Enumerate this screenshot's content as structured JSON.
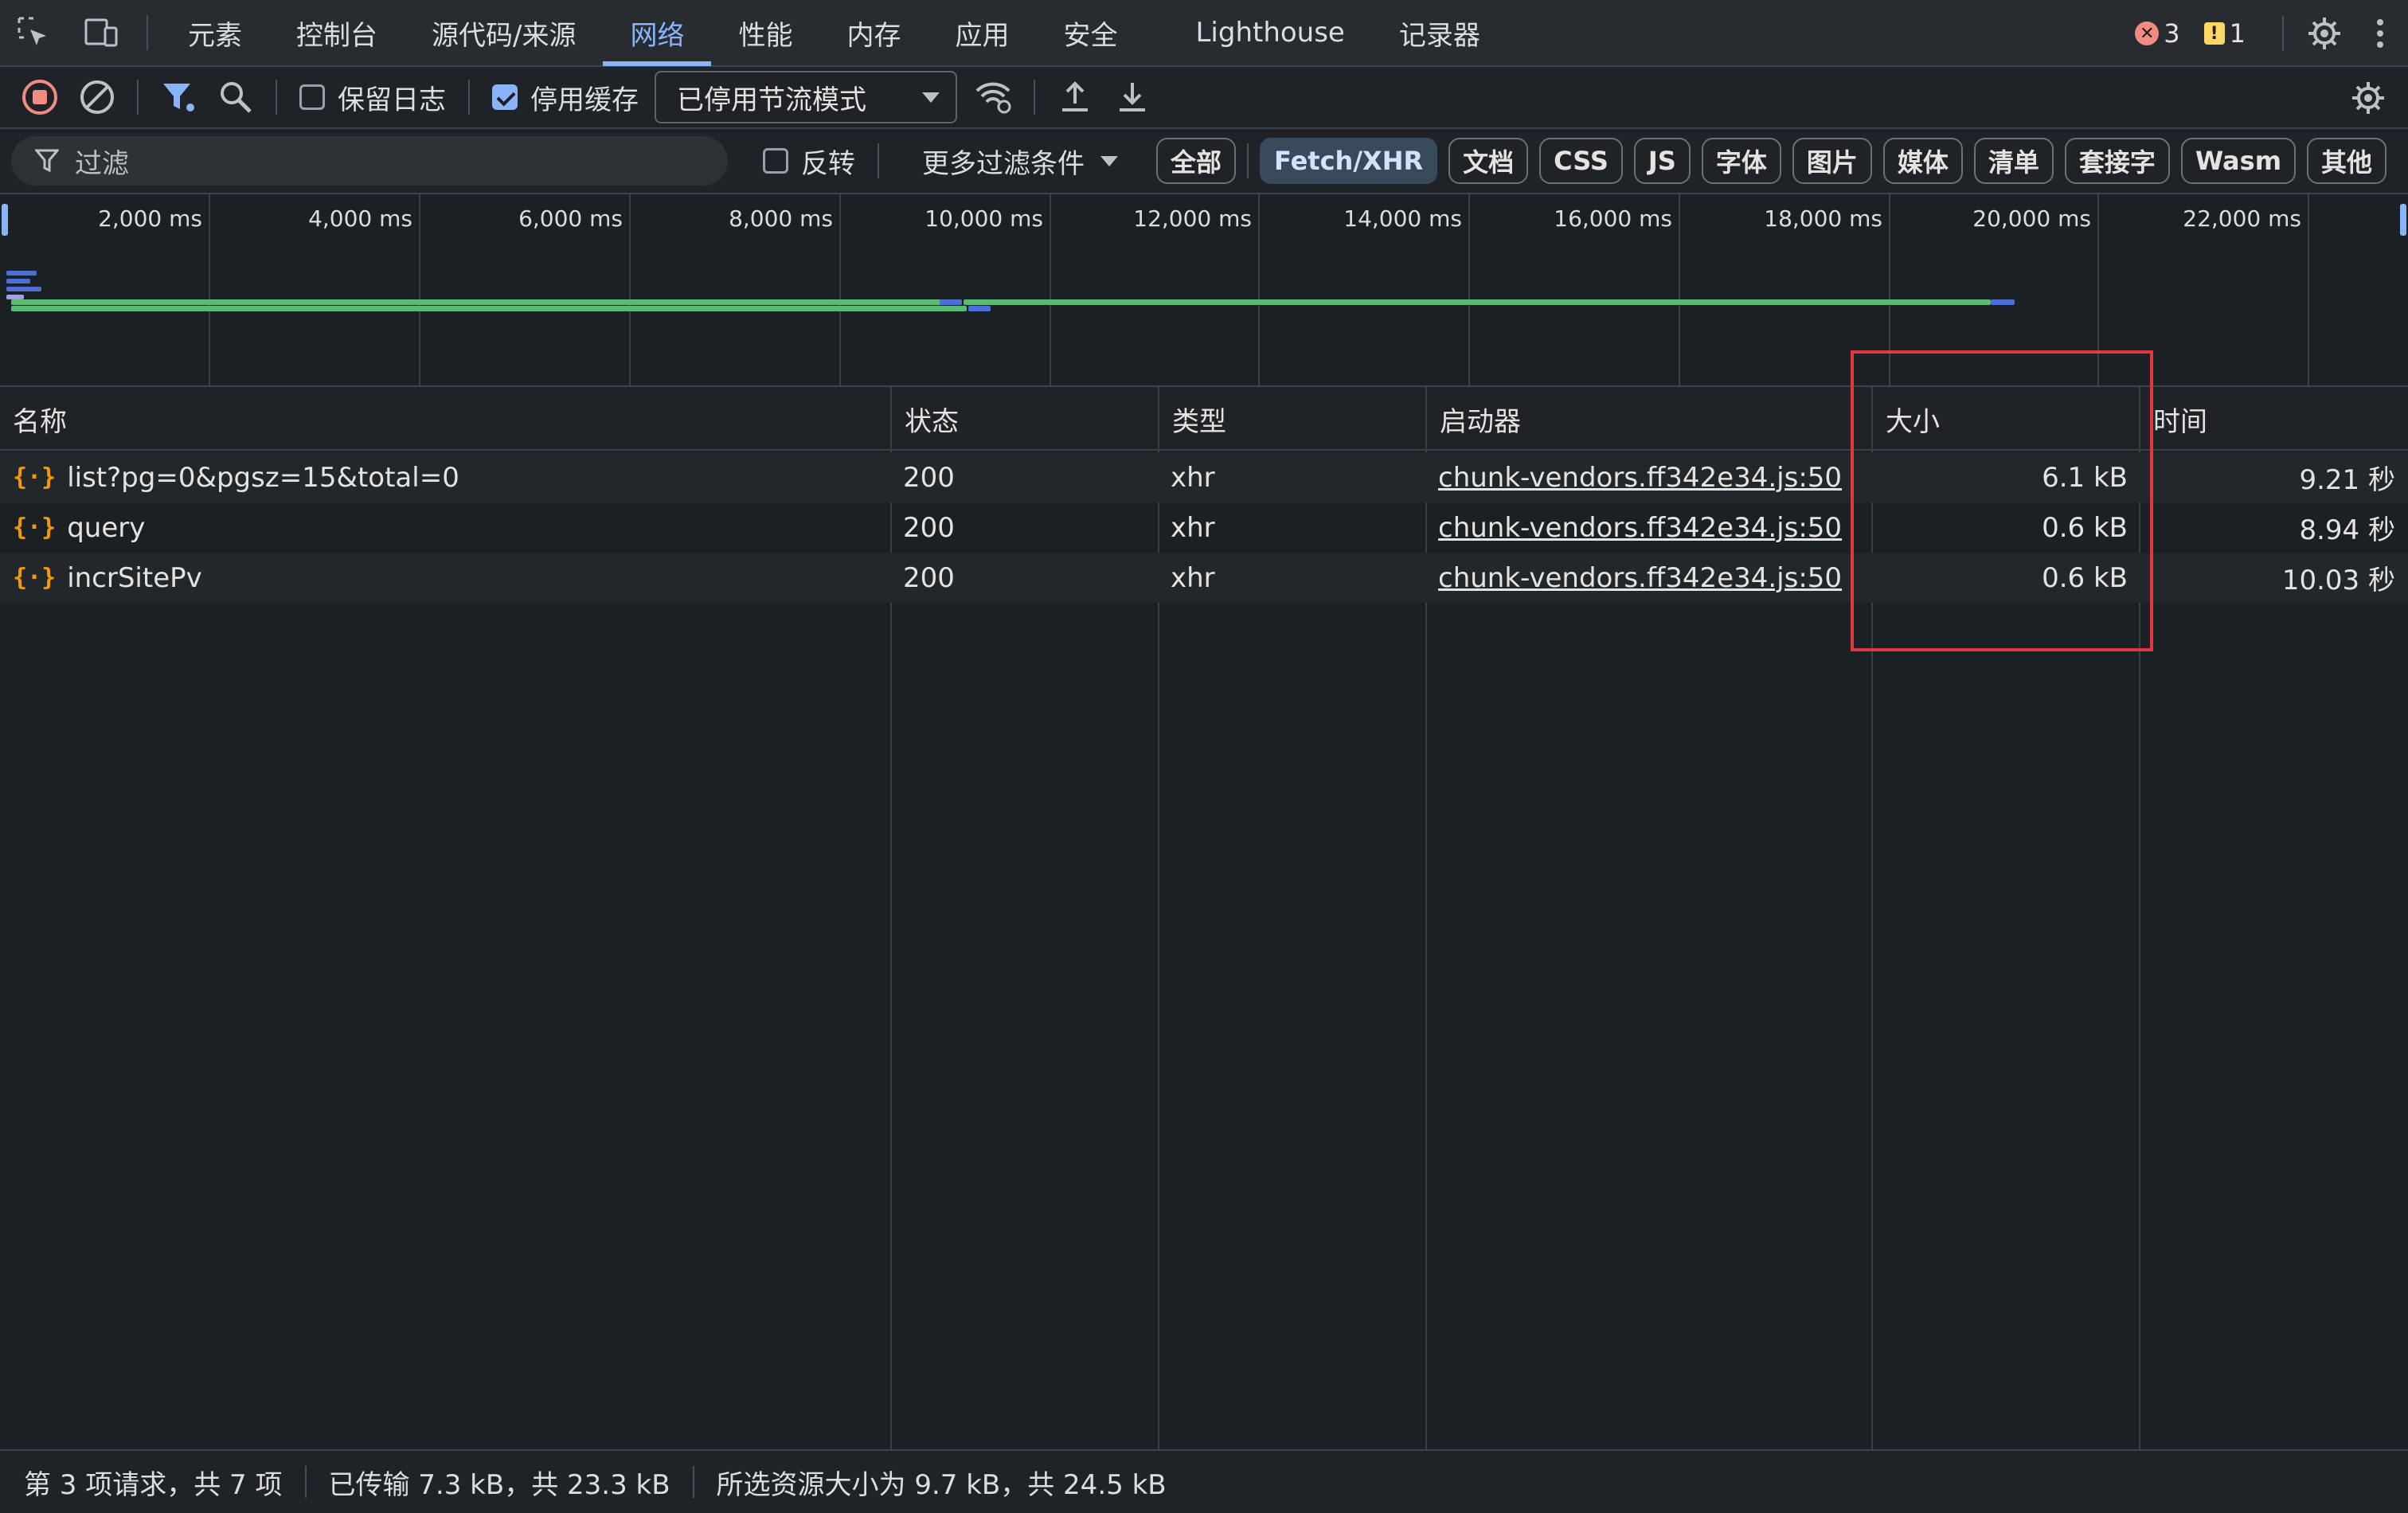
{
  "tabs": [
    "元素",
    "控制台",
    "源代码/来源",
    "网络",
    "性能",
    "内存",
    "应用",
    "安全",
    "Lighthouse",
    "记录器"
  ],
  "active_tab": "网络",
  "counts": {
    "errors": "3",
    "warnings": "1"
  },
  "toolbar": {
    "preserve_log": "保留日志",
    "disable_cache": "停用缓存",
    "throttle": "已停用节流模式"
  },
  "filter": {
    "placeholder": "过滤",
    "invert": "反转",
    "more_filters": "更多过滤条件",
    "chips": [
      "全部",
      "Fetch/XHR",
      "文档",
      "CSS",
      "JS",
      "字体",
      "图片",
      "媒体",
      "清单",
      "套接字",
      "Wasm",
      "其他"
    ],
    "selected_chip": "Fetch/XHR"
  },
  "timeline": {
    "ticks": [
      "2,000 ms",
      "4,000 ms",
      "6,000 ms",
      "8,000 ms",
      "10,000 ms",
      "12,000 ms",
      "14,000 ms",
      "16,000 ms",
      "18,000 ms",
      "20,000 ms",
      "22,000 ms"
    ]
  },
  "table": {
    "headers": {
      "name": "名称",
      "status": "状态",
      "type": "类型",
      "initiator": "启动器",
      "size": "大小",
      "time": "时间"
    },
    "rows": [
      {
        "name": "list?pg=0&pgsz=15&total=0",
        "status": "200",
        "type": "xhr",
        "initiator": "chunk-vendors.ff342e34.js:50",
        "size": "6.1 kB",
        "time": "9.21 秒"
      },
      {
        "name": "query",
        "status": "200",
        "type": "xhr",
        "initiator": "chunk-vendors.ff342e34.js:50",
        "size": "0.6 kB",
        "time": "8.94 秒"
      },
      {
        "name": "incrSitePv",
        "status": "200",
        "type": "xhr",
        "initiator": "chunk-vendors.ff342e34.js:50",
        "size": "0.6 kB",
        "time": "10.03 秒"
      }
    ]
  },
  "status": {
    "requests": "第 3 项请求，共 7 项",
    "transferred": "已传输 7.3 kB，共 23.3 kB",
    "resources": "所选资源大小为 9.7 kB，共 24.5 kB"
  },
  "colors": {
    "accent": "#8ab4f8",
    "highlight": "#e0383e",
    "xhr_icon": "#f29900",
    "waterfall_green": "#5bb974",
    "waterfall_blue": "#4b6fd6"
  }
}
